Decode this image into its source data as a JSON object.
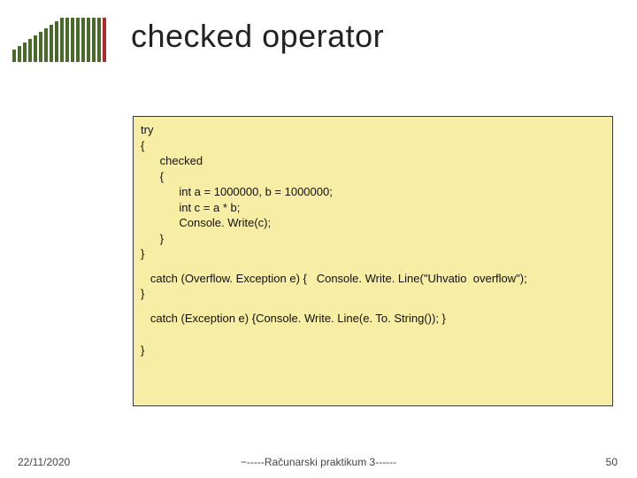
{
  "title": "checked operator",
  "code": {
    "l01": "try",
    "l02": "{",
    "l03": "      checked",
    "l04": "      {",
    "l05": "            int a = 1000000, b = 1000000;",
    "l06": "            int c = a * b;",
    "l07": "            Console. Write(c);",
    "l08": "      }",
    "l09": "}",
    "l10": "   catch (Overflow. Exception e) {   Console. Write. Line(\"Uhvatio  overflow\");",
    "l11": "}",
    "l12": "   catch (Exception e) {Console. Write. Line(e. To. String()); }",
    "l13": "}"
  },
  "footer": {
    "date": "22/11/2020",
    "center": "−-----Računarski praktikum 3------",
    "page": "50"
  }
}
